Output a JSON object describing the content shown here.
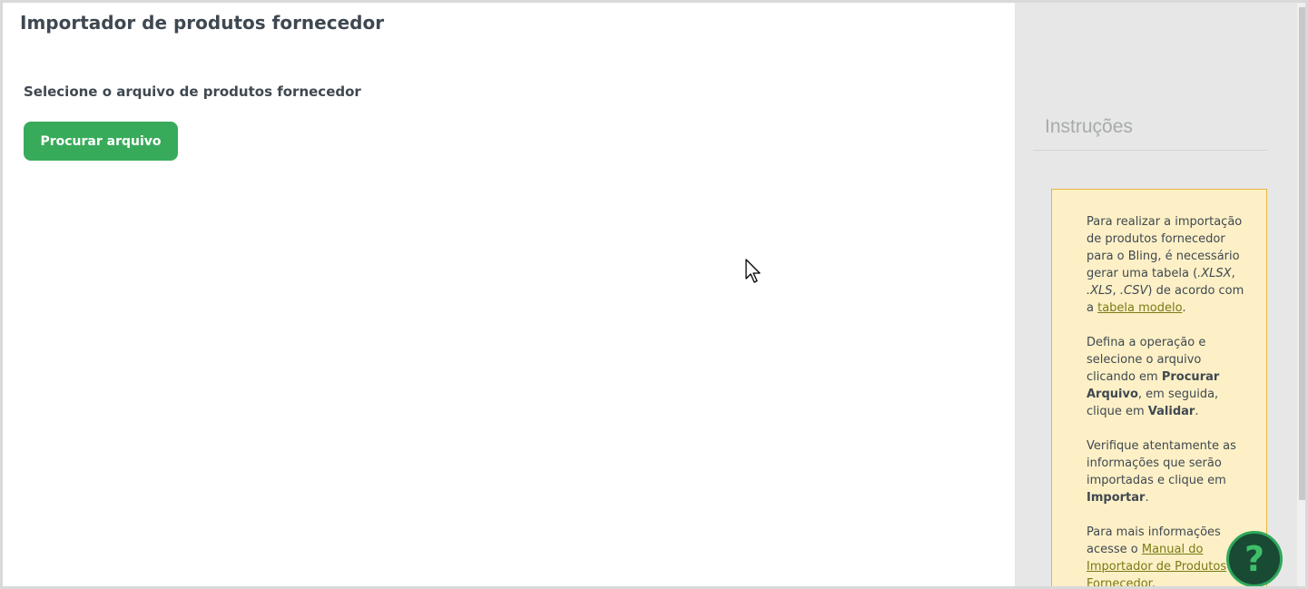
{
  "header": {
    "title": "Importador de produtos fornecedor"
  },
  "main": {
    "select_label": "Selecione o arquivo de produtos fornecedor",
    "browse_button_label": "Procurar arquivo"
  },
  "sidebar": {
    "heading": "Instruções",
    "p1_text1": "Para realizar a importação de produtos fornecedor para o Bling, é necessário gerar uma tabela (",
    "p1_ext1": ".XLSX",
    "p1_sep1": ", ",
    "p1_ext2": ".XLS",
    "p1_sep2": ", ",
    "p1_ext3": ".CSV",
    "p1_text2": ") de acordo com a ",
    "p1_link": "tabela modelo",
    "p1_end": ".",
    "p2_text1": "Defina a operação e selecione o arquivo clicando em ",
    "p2_bold1": "Procurar Arquivo",
    "p2_text2": ", em seguida, clique em ",
    "p2_bold2": "Validar",
    "p2_end": ".",
    "p3_text1": "Verifique atentamente as informações que serão importadas e clique em ",
    "p3_bold": "Importar",
    "p3_end": ".",
    "p4_text1": "Para mais informações acesse o ",
    "p4_link": "Manual do Importador de Produtos Fornecedor",
    "p4_end": "."
  },
  "help": {
    "icon": "question-mark-icon",
    "glyph": "?"
  },
  "colors": {
    "primary_green": "#38ab5b",
    "help_bg": "#194a34",
    "info_bg": "#fdf0c6",
    "info_border": "#e8b545",
    "link": "#7a7a16"
  }
}
